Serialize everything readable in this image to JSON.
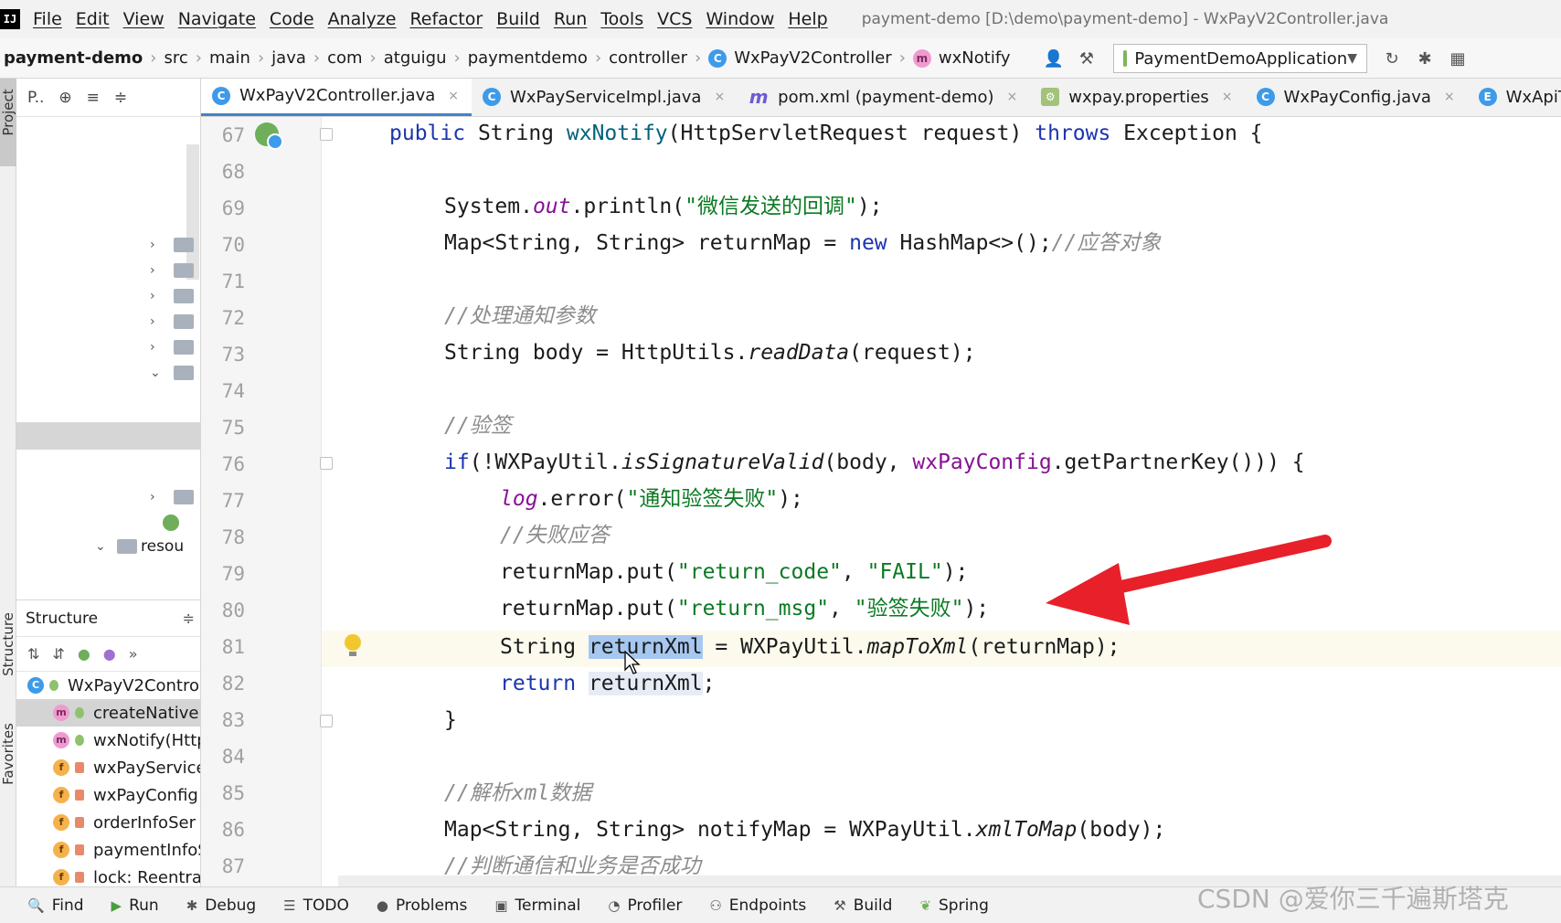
{
  "menu": {
    "logo": "IJ",
    "items": [
      "File",
      "Edit",
      "View",
      "Navigate",
      "Code",
      "Analyze",
      "Refactor",
      "Build",
      "Run",
      "Tools",
      "VCS",
      "Window",
      "Help"
    ],
    "window_title": "payment-demo [D:\\demo\\payment-demo] - WxPayV2Controller.java"
  },
  "breadcrumb": {
    "items": [
      "payment-demo",
      "src",
      "main",
      "java",
      "com",
      "atguigu",
      "paymentdemo",
      "controller"
    ],
    "class_name": "WxPayV2Controller",
    "method_name": "wxNotify",
    "run_config": "PaymentDemoApplication"
  },
  "left_strip": {
    "project_label": "Project",
    "structure_label": "Structure",
    "favorites_label": "Favorites"
  },
  "project_panel": {
    "toolbar_label": "P..",
    "partial_item": "resou"
  },
  "structure_panel": {
    "title": "Structure",
    "items": [
      {
        "badge": "c",
        "label": "WxPayV2Contro"
      },
      {
        "badge": "m",
        "label": "createNative("
      },
      {
        "badge": "m",
        "label": "wxNotify(Http"
      },
      {
        "badge": "f",
        "label": "wxPayService"
      },
      {
        "badge": "f",
        "label": "wxPayConfig:"
      },
      {
        "badge": "f",
        "label": "orderInfoSer"
      },
      {
        "badge": "f",
        "label": "paymentInfoS"
      },
      {
        "badge": "f",
        "label": "lock: Reentra"
      }
    ]
  },
  "editor_tabs": [
    {
      "label": "WxPayV2Controller.java",
      "icon": "class-icon"
    },
    {
      "label": "WxPayServiceImpl.java",
      "icon": "class-icon"
    },
    {
      "label": "pom.xml (payment-demo)",
      "icon": "maven-icon"
    },
    {
      "label": "wxpay.properties",
      "icon": "properties-icon"
    },
    {
      "label": "WxPayConfig.java",
      "icon": "class-icon"
    },
    {
      "label": "WxApiType.java",
      "icon": "enum-icon"
    }
  ],
  "line_numbers": [
    "67",
    "68",
    "69",
    "70",
    "71",
    "72",
    "73",
    "74",
    "75",
    "76",
    "77",
    "78",
    "79",
    "80",
    "81",
    "82",
    "83",
    "84",
    "85",
    "86",
    "87"
  ],
  "code": {
    "l67_kw": "public",
    "l67_a": " String ",
    "l67_fn": "wxNotify",
    "l67_b": "(HttpServletRequest request) ",
    "l67_kw2": "throws",
    "l67_c": " Exception {",
    "l69_a": "System.",
    "l69_out": "out",
    "l69_b": ".println(",
    "l69_str": "\"微信发送的回调\"",
    "l69_c": ");",
    "l70_a": "Map<String, String> returnMap = ",
    "l70_new": "new",
    "l70_b": " HashMap<>();",
    "l70_cmt": "//应答对象",
    "l72_cmt": "//处理通知参数",
    "l73_a": "String body = HttpUtils.",
    "l73_fn": "readData",
    "l73_b": "(request);",
    "l75_cmt": "//验签",
    "l76_if": "if",
    "l76_a": "(!WXPayUtil.",
    "l76_fn": "isSignatureValid",
    "l76_b": "(body, ",
    "l76_fld": "wxPayConfig",
    "l76_c": ".getPartnerKey())) {",
    "l77_log": "log",
    "l77_a": ".error(",
    "l77_str": "\"通知验签失败\"",
    "l77_b": ");",
    "l78_cmt": "//失败应答",
    "l79_a": "returnMap.put(",
    "l79_str1": "\"return_code\"",
    "l79_b": ", ",
    "l79_str2": "\"FAIL\"",
    "l79_c": ");",
    "l80_a": "returnMap.put(",
    "l80_str1": "\"return_msg\"",
    "l80_b": ", ",
    "l80_str2": "\"验签失败\"",
    "l80_c": ");",
    "l81_a": "String ",
    "l81_sel": "returnXml",
    "l81_b": " = WXPayUtil.",
    "l81_fn": "mapToXml",
    "l81_c": "(returnMap);",
    "l82_kw": "return",
    "l82_a": " ",
    "l82_var": "returnXml",
    "l82_b": ";",
    "l83_a": "}",
    "l85_cmt": "//解析xml数据",
    "l86_a": "Map<String, String> notifyMap = WXPayUtil.",
    "l86_fn": "xmlToMap",
    "l86_b": "(body);",
    "l87_cmt": "//判断通信和业务是否成功"
  },
  "bottom_tools": [
    {
      "icon": "search-icon",
      "glyph": "🔍",
      "label": "Find"
    },
    {
      "icon": "run-icon",
      "glyph": "▶",
      "label": "Run"
    },
    {
      "icon": "debug-icon",
      "glyph": "✱",
      "label": "Debug"
    },
    {
      "icon": "todo-icon",
      "glyph": "☰",
      "label": "TODO"
    },
    {
      "icon": "problems-icon",
      "glyph": "●",
      "label": "Problems"
    },
    {
      "icon": "terminal-icon",
      "glyph": "▣",
      "label": "Terminal"
    },
    {
      "icon": "profiler-icon",
      "glyph": "◔",
      "label": "Profiler"
    },
    {
      "icon": "endpoints-icon",
      "glyph": "⚇",
      "label": "Endpoints"
    },
    {
      "icon": "build-icon",
      "glyph": "⚒",
      "label": "Build"
    },
    {
      "icon": "spring-icon",
      "glyph": "❦",
      "label": "Spring"
    }
  ],
  "watermark": "CSDN @爱你三千遍斯塔克",
  "colors": {
    "keyword": "#1b35b1",
    "string": "#0b7a23",
    "comment": "#8c8c8c",
    "field": "#871094",
    "method_decl": "#00627a",
    "annotation_arrow": "#e8202a",
    "selection": "#a6c8f0"
  }
}
